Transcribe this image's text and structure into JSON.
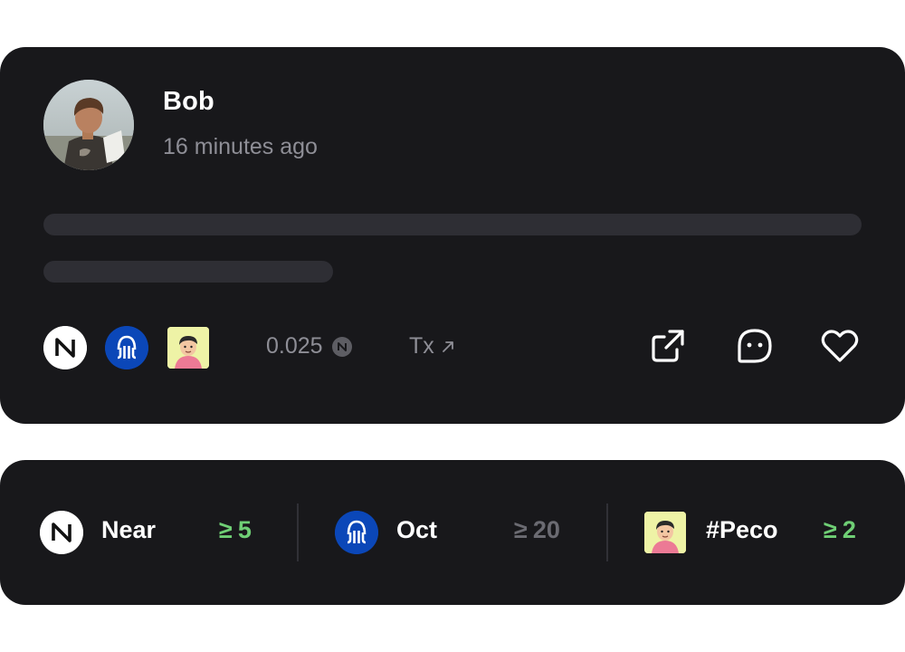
{
  "post": {
    "author": "Bob",
    "timestamp": "16 minutes ago",
    "amount": "0.025",
    "tx_label": "Tx",
    "tokens": [
      "near-icon",
      "octopus-icon",
      "peco-avatar-icon"
    ],
    "actions": [
      "share-icon",
      "comment-icon",
      "heart-icon"
    ]
  },
  "requirements": [
    {
      "name": "Near",
      "symbol": "≥",
      "count": "5",
      "status_color": "#6fcf75"
    },
    {
      "name": "Oct",
      "symbol": "≥",
      "count": "20",
      "status_color": "#6b6b72"
    },
    {
      "name": "#Peco",
      "symbol": "≥",
      "count": "2",
      "status_color": "#6fcf75"
    }
  ],
  "colors": {
    "card": "#18181b",
    "skeleton": "#2e2e34",
    "muted_text": "#8e8e96",
    "green": "#6fcf75",
    "octopus_blue": "#0b47b8"
  }
}
